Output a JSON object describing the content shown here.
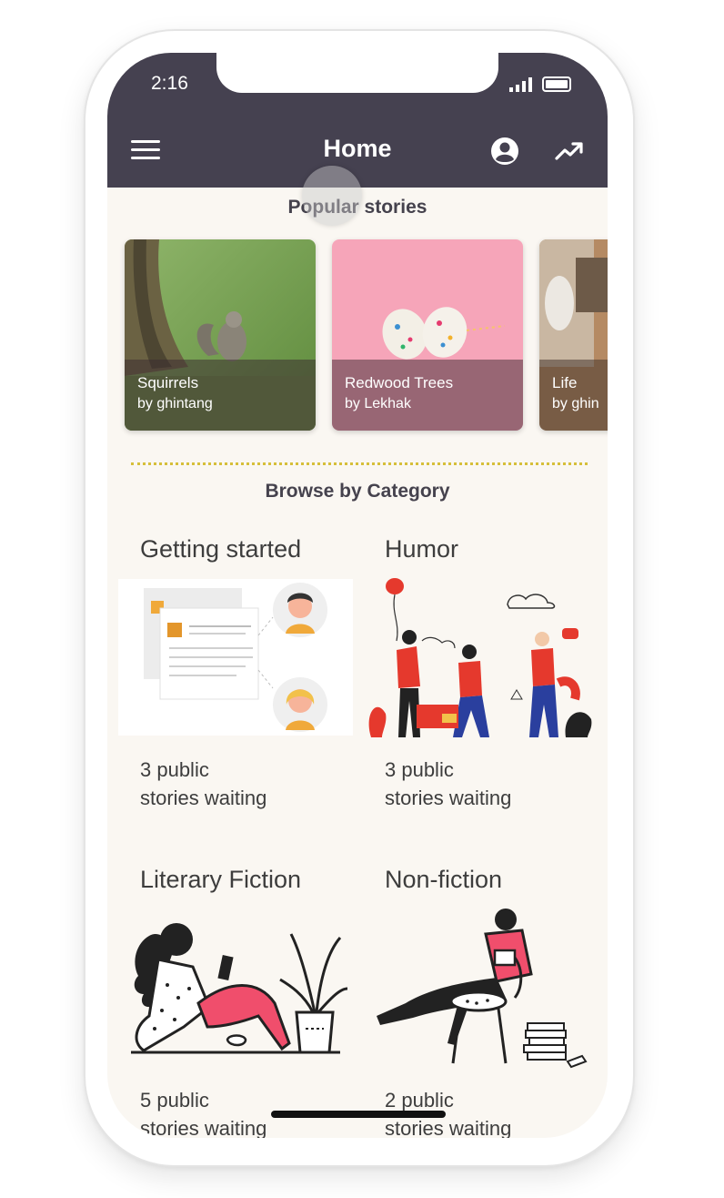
{
  "status_bar": {
    "time": "2:16"
  },
  "app_bar": {
    "title": "Home",
    "menu_icon": "hamburger-menu-icon",
    "account_icon": "account-circle-icon",
    "trending_icon": "trending-up-icon",
    "background": "#454150"
  },
  "popular": {
    "heading": "Popular stories",
    "stories": [
      {
        "title": "Squirrels",
        "author": "by ghintang"
      },
      {
        "title": "Redwood Trees",
        "author": "by Lekhak"
      },
      {
        "title": "Life",
        "author": "by ghin"
      }
    ]
  },
  "browse": {
    "heading": "Browse by Category",
    "categories": [
      {
        "title": "Getting started",
        "count_line1": "3 public",
        "count_line2": "stories waiting"
      },
      {
        "title": "Humor",
        "count_line1": "3 public",
        "count_line2": "stories waiting"
      },
      {
        "title": "Literary Fiction",
        "count_line1": "5 public",
        "count_line2": "stories waiting"
      },
      {
        "title": "Non-fiction",
        "count_line1": "2 public",
        "count_line2": "stories waiting"
      }
    ]
  },
  "colors": {
    "accent_divider": "#d6bf3a",
    "screen_bg": "#faf7f2",
    "illustration_red": "#e5392d"
  }
}
